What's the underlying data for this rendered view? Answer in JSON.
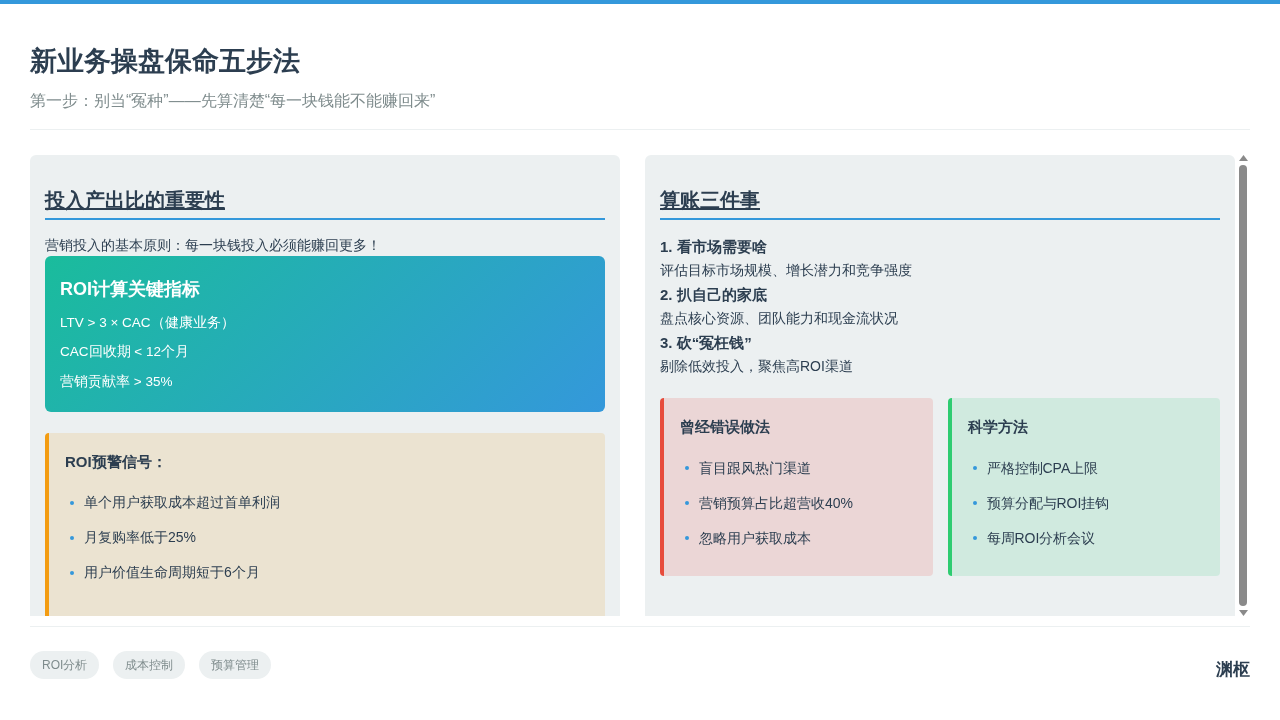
{
  "header": {
    "title": "新业务操盘保命五步法",
    "subtitle": "第一步：别当“冤种”——先算清楚“每一块钱能不能赚回来”"
  },
  "left_panel": {
    "heading": "投入产出比的重要性",
    "intro": "营销投入的基本原则：每一块钱投入必须能赚回更多！",
    "metrics_card": {
      "title": "ROI计算关键指标",
      "items": [
        "LTV > 3 × CAC（健康业务）",
        "CAC回收期 < 12个月",
        "营销贡献率 > 35%"
      ]
    },
    "warning_card": {
      "title": "ROI预警信号：",
      "items": [
        "单个用户获取成本超过首单利润",
        "月复购率低于25%",
        "用户价值生命周期短于6个月"
      ]
    }
  },
  "right_panel": {
    "heading": "算账三件事",
    "steps": [
      {
        "title": "1. 看市场需要啥",
        "description": "评估目标市场规模、增长潜力和竞争强度"
      },
      {
        "title": "2. 扒自己的家底",
        "description": "盘点核心资源、团队能力和现金流状况"
      },
      {
        "title": "3. 砍“冤枉钱”",
        "description": "剔除低效投入，聚焦高ROI渠道"
      }
    ],
    "compare_cards": [
      {
        "kind": "wrong",
        "title": "曾经错误做法",
        "items": [
          "盲目跟风热门渠道",
          "营销预算占比超营收40%",
          "忽略用户获取成本"
        ]
      },
      {
        "kind": "right",
        "title": "科学方法",
        "items": [
          "严格控制CPA上限",
          "预算分配与ROI挂钩",
          "每周ROI分析会议"
        ]
      }
    ]
  },
  "footer": {
    "tags": [
      "ROI分析",
      "成本控制",
      "预算管理"
    ],
    "brand": "渊枢"
  }
}
